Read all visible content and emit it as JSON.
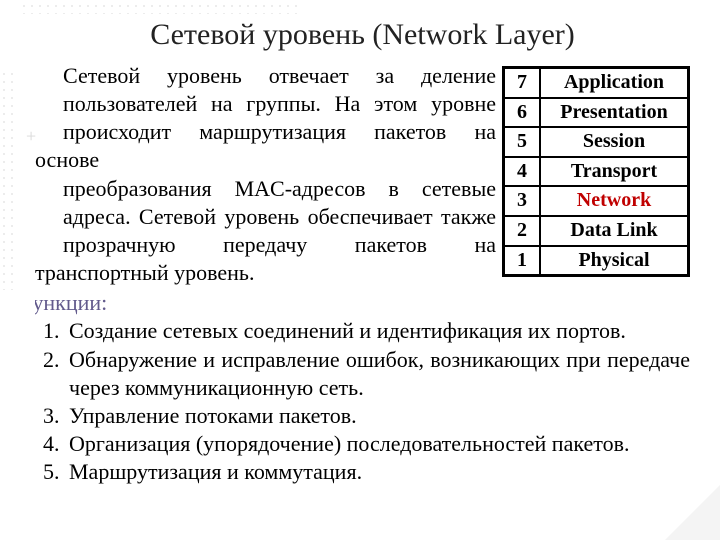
{
  "title": "Сетевой уровень (Network Layer)",
  "paragraph_lines": [
    "Сетевой уровень отвечает за деление",
    "пользователей на группы. На этом уровне",
    "происходит маршрутизация пакетов на основе",
    "преобразования MAC-адресов в сетевые",
    "адреса. Сетевой уровень обеспечивает также",
    "прозрачную передачу пакетов на"
  ],
  "paragraph_tail": "транспортный уровень.",
  "functions_label": "Функции:",
  "functions": [
    "Создание сетевых соединений и идентификация их портов.",
    "Обнаружение и исправление ошибок, возникающих при передаче через коммуникационную сеть.",
    "Управление потоками пакетов.",
    "Организация (упорядочение) последовательностей пакетов.",
    "Маршрутизация и коммутация."
  ],
  "osi_layers": [
    {
      "num": "7",
      "name": "Application",
      "highlight": false
    },
    {
      "num": "6",
      "name": "Presentation",
      "highlight": false
    },
    {
      "num": "5",
      "name": "Session",
      "highlight": false
    },
    {
      "num": "4",
      "name": "Transport",
      "highlight": false
    },
    {
      "num": "3",
      "name": "Network",
      "highlight": true
    },
    {
      "num": "2",
      "name": "Data Link",
      "highlight": false
    },
    {
      "num": "1",
      "name": "Physical",
      "highlight": false
    }
  ]
}
